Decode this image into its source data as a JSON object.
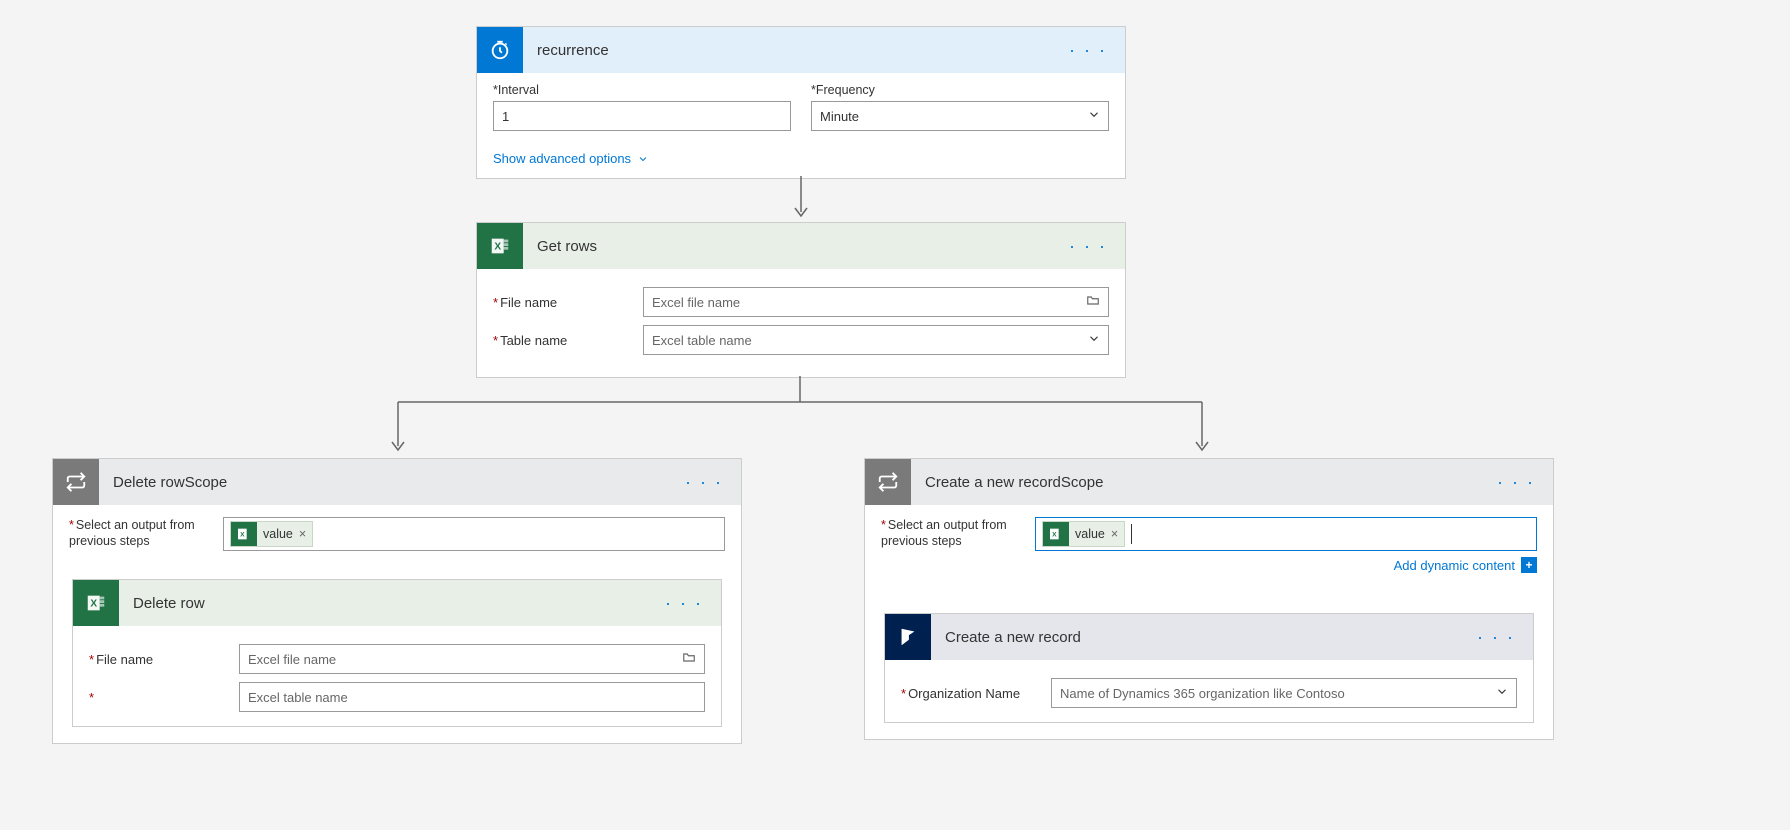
{
  "recurrence": {
    "title": "recurrence",
    "interval_label": "Interval",
    "interval_value": "1",
    "frequency_label": "Frequency",
    "frequency_value": "Minute",
    "advanced_link": "Show advanced options"
  },
  "getrows": {
    "title": "Get rows",
    "file_label": "File name",
    "file_placeholder": "Excel file name",
    "table_label": "Table name",
    "table_placeholder": "Excel table name"
  },
  "delete_scope": {
    "title": "Delete rowScope",
    "select_label": "Select an output from previous steps",
    "token": "value",
    "inner": {
      "title": "Delete row",
      "file_label": "File name",
      "file_placeholder": "Excel file name",
      "table_placeholder": "Excel table name"
    }
  },
  "create_scope": {
    "title": "Create a new recordScope",
    "select_label": "Select an output from previous steps",
    "token": "value",
    "add_dynamic": "Add dynamic content",
    "inner": {
      "title": "Create a new record",
      "org_label": "Organization Name",
      "org_placeholder": "Name of Dynamics 365 organization like Contoso"
    }
  }
}
